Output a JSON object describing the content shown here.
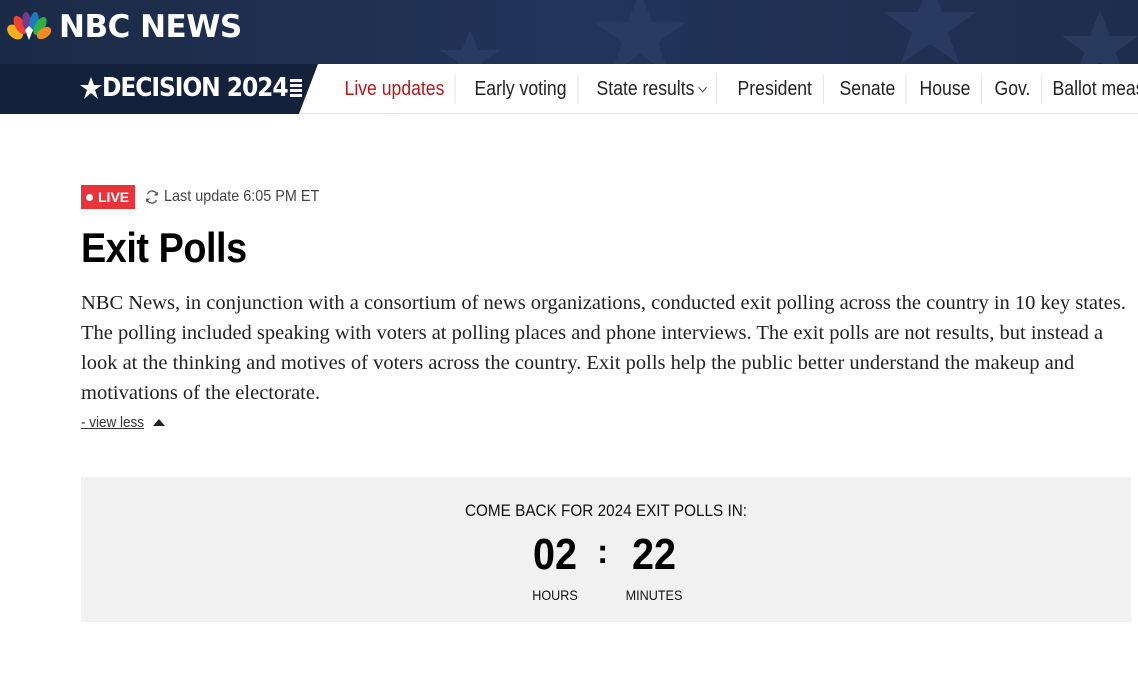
{
  "brand": {
    "name": "NBC NEWS"
  },
  "decision": {
    "label": "DECISION 2024"
  },
  "nav": {
    "items": [
      {
        "label": "Live updates",
        "active": true
      },
      {
        "label": "Early voting"
      },
      {
        "label": "State results",
        "has_dropdown": true
      },
      {
        "label": "President"
      },
      {
        "label": "Senate"
      },
      {
        "label": "House"
      },
      {
        "label": "Gov."
      },
      {
        "label": "Ballot measures"
      }
    ]
  },
  "status": {
    "live_label": "LIVE",
    "last_update": "Last update 6:05 PM ET"
  },
  "page": {
    "title": "Exit Polls",
    "intro": "NBC News, in conjunction with a consortium of news organizations, conducted exit polling across the country in 10 key states. The polling included speaking with voters at polling places and phone interviews. The exit polls are not results, but instead a look at the thinking and motives of voters across the country. Exit polls help the public better understand the makeup and motivations of the electorate.",
    "view_less": "- view less"
  },
  "countdown": {
    "heading": "COME BACK FOR 2024 EXIT POLLS IN:",
    "hours": "02",
    "hours_label": "HOURS",
    "separator": ":",
    "minutes": "22",
    "minutes_label": "MINUTES"
  },
  "colors": {
    "brand_navy": "#1b2a46",
    "live_red": "#e8333b",
    "active_nav": "#b5161a",
    "countdown_bg": "#f1f1f1"
  }
}
